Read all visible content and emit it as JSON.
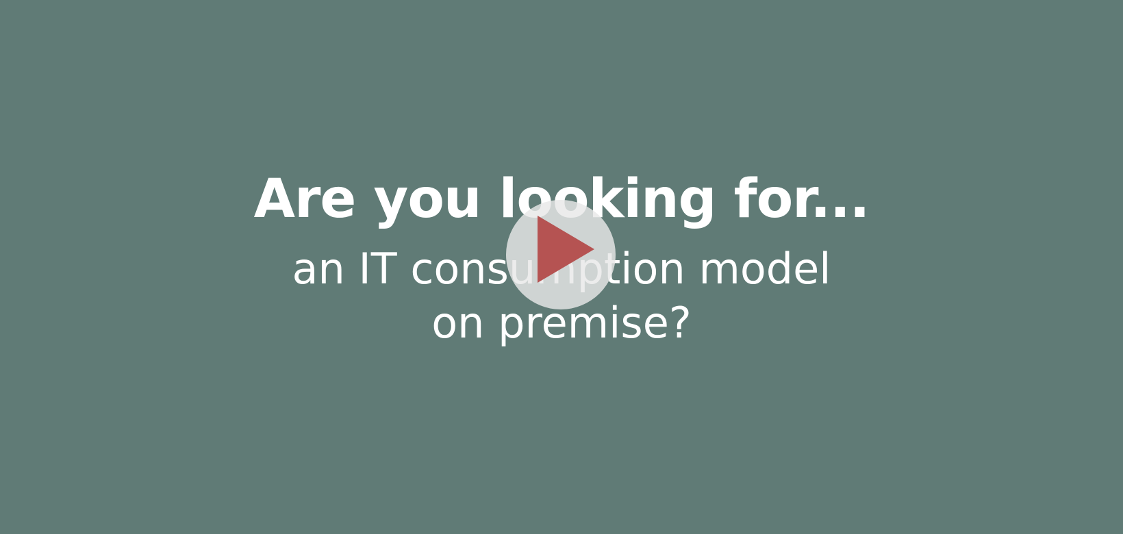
{
  "video": {
    "background_color": "#607b76",
    "headline": "Are you looking for...",
    "subline_1": "an IT consumption model",
    "subline_2": "on premise?",
    "play_icon_color": "#b55352",
    "play_icon": "play-icon"
  }
}
